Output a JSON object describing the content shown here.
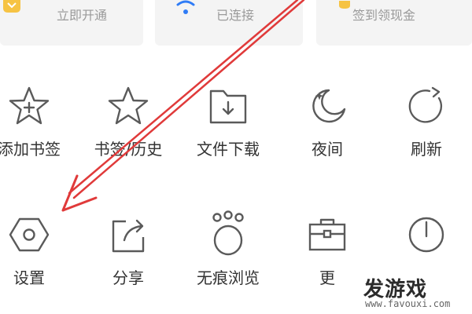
{
  "colors": {
    "icon_stroke": "#5a5a5a",
    "label_text": "#333333",
    "muted_text": "#9a9a9a",
    "card_bg": "#f4f4f4",
    "vip_icon": "#f6c343",
    "wifi_icon": "#2f7cf6",
    "coin_icon": "#f6c343",
    "arrow": "#e03a3a"
  },
  "top_cards": [
    {
      "label": "立即开通",
      "icon": "vip-icon"
    },
    {
      "label": "已连接",
      "icon": "wifi-icon"
    },
    {
      "label": "签到领现金",
      "icon": "coin-icon"
    }
  ],
  "menu": [
    {
      "label": "添加书签",
      "icon": "star-plus-icon"
    },
    {
      "label": "书签/历史",
      "icon": "star-icon"
    },
    {
      "label": "文件下载",
      "icon": "folder-download-icon"
    },
    {
      "label": "夜间",
      "icon": "moon-icon"
    },
    {
      "label": "刷新",
      "icon": "refresh-icon"
    },
    {
      "label": "设置",
      "icon": "hexagon-settings-icon"
    },
    {
      "label": "分享",
      "icon": "share-icon"
    },
    {
      "label": "无痕浏览",
      "icon": "paw-incognito-icon"
    },
    {
      "label": "更",
      "icon": "toolbox-icon"
    },
    {
      "label": "",
      "icon": "power-icon"
    }
  ],
  "watermark": {
    "brand": "发游戏",
    "url": "www.favouxi.com"
  }
}
